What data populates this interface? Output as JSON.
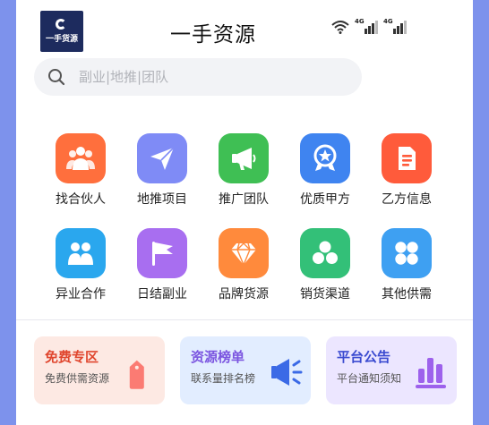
{
  "header": {
    "logo_text": "一手货源",
    "title": "一手资源",
    "status": {
      "wifi_icon": "wifi-icon",
      "signal_1_label": "4G",
      "signal_2_label": "4G"
    }
  },
  "search": {
    "placeholder": "副业|地推|团队",
    "icon": "search-icon"
  },
  "grid": [
    {
      "label": "找合伙人",
      "icon": "people-icon",
      "color": "#ff6f3d"
    },
    {
      "label": "地推项目",
      "icon": "paper-plane-icon",
      "color": "#7f8bf6"
    },
    {
      "label": "推广团队",
      "icon": "megaphone-icon",
      "color": "#3fbf54"
    },
    {
      "label": "优质甲方",
      "icon": "star-badge-icon",
      "color": "#3f84f0"
    },
    {
      "label": "乙方信息",
      "icon": "document-icon",
      "color": "#ff5b3b"
    },
    {
      "label": "异业合作",
      "icon": "handshake-icon",
      "color": "#2aa7ee"
    },
    {
      "label": "日结副业",
      "icon": "flag-icon",
      "color": "#a86ef0"
    },
    {
      "label": "品牌货源",
      "icon": "diamond-icon",
      "color": "#ff8a3c"
    },
    {
      "label": "销货渠道",
      "icon": "cubes-icon",
      "color": "#33c078"
    },
    {
      "label": "其他供需",
      "icon": "grid-icon",
      "color": "#3ea0f2"
    }
  ],
  "cards": [
    {
      "title": "免费专区",
      "subtitle": "免费供需资源",
      "icon": "tag-icon",
      "bg": "#fde9e3",
      "title_color": "#e0462e"
    },
    {
      "title": "资源榜单",
      "subtitle": "联系量排名榜",
      "icon": "loudspeaker-icon",
      "bg": "#e2edff",
      "title_color": "#7b55e0"
    },
    {
      "title": "平台公告",
      "subtitle": "平台通知须知",
      "icon": "bar-chart-icon",
      "bg": "#ece6ff",
      "title_color": "#3a4ad0"
    }
  ]
}
